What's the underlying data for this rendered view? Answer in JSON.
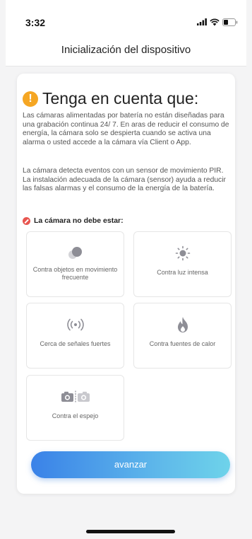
{
  "status_bar": {
    "time": "3:32"
  },
  "header": {
    "title": "Inicialización del dispositivo"
  },
  "notice": {
    "icon": "exclamation-icon",
    "title": "Tenga en cuenta que:",
    "paragraphs": [
      "Las cámaras alimentadas por batería no están diseñadas para una grabación continua 24/ 7. En aras de reducir el consumo de energía, la cámara solo se despierta cuando se activa una alarma o usted accede a la cámara vía Client o App.",
      "La cámara detecta eventos con un sensor de movimiento PIR. La instalación adecuada de la cámara (sensor) ayuda a reducir las falsas alarmas y el consumo de la energía de la batería."
    ]
  },
  "placement": {
    "heading": "La cámara no debe estar:",
    "items": [
      {
        "label": "Contra objetos en movimiento frecuente",
        "icon": "moving-objects-icon"
      },
      {
        "label": "Contra luz intensa",
        "icon": "sun-icon"
      },
      {
        "label": "Cerca de señales fuertes",
        "icon": "signal-icon"
      },
      {
        "label": "Contra fuentes de calor",
        "icon": "flame-icon"
      },
      {
        "label": "Contra el espejo",
        "icon": "camera-mirror-icon"
      }
    ]
  },
  "actions": {
    "advance_label": "avanzar"
  },
  "colors": {
    "accent_start": "#3a82e8",
    "accent_end": "#6ed3ea",
    "warning": "#f5a623",
    "danger": "#e8554f"
  }
}
